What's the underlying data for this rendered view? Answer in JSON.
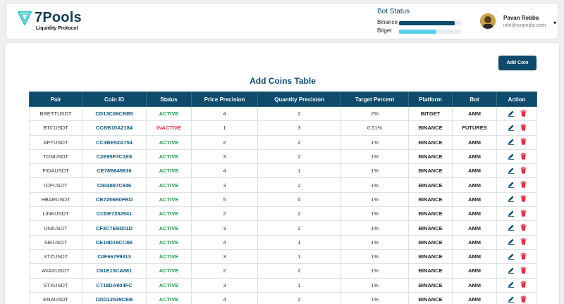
{
  "brand": {
    "name": "7Pools",
    "tagline": "Liquidity Protocol",
    "color": "#0d4a6b",
    "accent": "#3ec6c9"
  },
  "bot_status": {
    "title": "Bot Status",
    "items": [
      {
        "label": "Binance",
        "level": 0.9,
        "color": "#0d4a6b"
      },
      {
        "label": "Bitget",
        "level": 0.6,
        "color": "#5bd0ee"
      }
    ]
  },
  "user": {
    "name": "Pavan Rebba",
    "email": "info@example.com",
    "caret": "▾"
  },
  "actions": {
    "add_coin_label": "Add Coin"
  },
  "table": {
    "title": "Add Coins Table",
    "columns": [
      "Pair",
      "Coin ID",
      "Status",
      "Price Precision",
      "Quantity Precision",
      "Target Percent",
      "Platform",
      "Bot",
      "Action"
    ],
    "rows": [
      {
        "pair": "BRETTUSDT",
        "coin_id": "CD13C06CBB5",
        "status": "ACTIVE",
        "price_precision": "4",
        "quantity_precision": "2",
        "target_percent": "2%",
        "platform": "BITGET",
        "bot": "AMM"
      },
      {
        "pair": "BTCUSDT",
        "coin_id": "CCBB10A2184",
        "status": "INACTIVE",
        "price_precision": "1",
        "quantity_precision": "3",
        "target_percent": "0.51%",
        "platform": "BINANCE",
        "bot": "FUTURES"
      },
      {
        "pair": "APTUSDT",
        "coin_id": "CC3BE52A754",
        "status": "ACTIVE",
        "price_precision": "2",
        "quantity_precision": "2",
        "target_percent": "1%",
        "platform": "BINANCE",
        "bot": "AMM"
      },
      {
        "pair": "TONUSDT",
        "coin_id": "C2E95F7C1E8",
        "status": "ACTIVE",
        "price_precision": "3",
        "quantity_precision": "2",
        "target_percent": "1%",
        "platform": "BINANCE",
        "bot": "AMM"
      },
      {
        "pair": "FIDAUSDT",
        "coin_id": "CE78B649816",
        "status": "ACTIVE",
        "price_precision": "4",
        "quantity_precision": "1",
        "target_percent": "1%",
        "platform": "BINANCE",
        "bot": "AMM"
      },
      {
        "pair": "ICPUSDT",
        "coin_id": "C844897C946",
        "status": "ACTIVE",
        "price_precision": "3",
        "quantity_precision": "2",
        "target_percent": "1%",
        "platform": "BINANCE",
        "bot": "AMM"
      },
      {
        "pair": "HBARUSDT",
        "coin_id": "CB7256B0FBD",
        "status": "ACTIVE",
        "price_precision": "5",
        "quantity_precision": "0",
        "target_percent": "1%",
        "platform": "BINANCE",
        "bot": "AMM"
      },
      {
        "pair": "LINKUSDT",
        "coin_id": "CCDE7252941",
        "status": "ACTIVE",
        "price_precision": "2",
        "quantity_precision": "2",
        "target_percent": "1%",
        "platform": "BINANCE",
        "bot": "AMM"
      },
      {
        "pair": "UNIUSDT",
        "coin_id": "CF3C7E93D1D",
        "status": "ACTIVE",
        "price_precision": "3",
        "quantity_precision": "2",
        "target_percent": "1%",
        "platform": "BINANCE",
        "bot": "AMM"
      },
      {
        "pair": "SEIUSDT",
        "coin_id": "CE18D16CC8E",
        "status": "ACTIVE",
        "price_precision": "4",
        "quantity_precision": "1",
        "target_percent": "1%",
        "platform": "BINANCE",
        "bot": "AMM"
      },
      {
        "pair": "XTZUSDT",
        "coin_id": "C0F66799313",
        "status": "ACTIVE",
        "price_precision": "3",
        "quantity_precision": "1",
        "target_percent": "1%",
        "platform": "BINANCE",
        "bot": "AMM"
      },
      {
        "pair": "AVAXUSDT",
        "coin_id": "C61E15CA881",
        "status": "ACTIVE",
        "price_precision": "2",
        "quantity_precision": "2",
        "target_percent": "1%",
        "platform": "BINANCE",
        "bot": "AMM"
      },
      {
        "pair": "STXUSDT",
        "coin_id": "C718DA904FC",
        "status": "ACTIVE",
        "price_precision": "3",
        "quantity_precision": "1",
        "target_percent": "1%",
        "platform": "BINANCE",
        "bot": "AMM"
      },
      {
        "pair": "ENAUSDT",
        "coin_id": "CDD12539CEB",
        "status": "ACTIVE",
        "price_precision": "4",
        "quantity_precision": "2",
        "target_percent": "1%",
        "platform": "BINANCE",
        "bot": "AMM"
      }
    ]
  },
  "icons": {
    "edit": "pencil-icon",
    "delete": "trash-icon"
  },
  "status_colors": {
    "active": "#1f9d4a",
    "inactive": "#dc3545"
  }
}
